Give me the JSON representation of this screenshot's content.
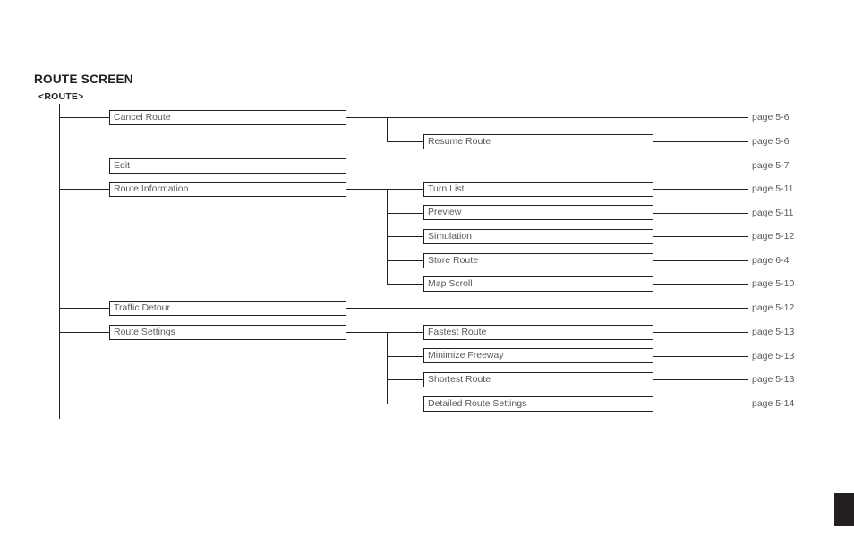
{
  "header": {
    "title": "ROUTE SCREEN",
    "subtitle": "<ROUTE>"
  },
  "chart_data": {
    "type": "diagram",
    "title": "ROUTE SCREEN",
    "subtitle": "<ROUTE>",
    "root": "<ROUTE>",
    "nodes": [
      {
        "id": "cancel-route",
        "level": 1,
        "label": "Cancel Route",
        "page": "page 5-6",
        "children": [
          {
            "id": "resume-route",
            "level": 2,
            "label": "Resume Route",
            "page": "page 5-6"
          }
        ]
      },
      {
        "id": "edit",
        "level": 1,
        "label": "Edit",
        "page": "page 5-7",
        "children": []
      },
      {
        "id": "route-information",
        "level": 1,
        "label": "Route Information",
        "page": null,
        "children": [
          {
            "id": "turn-list",
            "level": 2,
            "label": "Turn List",
            "page": "page 5-11"
          },
          {
            "id": "preview",
            "level": 2,
            "label": "Preview",
            "page": "page 5-11"
          },
          {
            "id": "simulation",
            "level": 2,
            "label": "Simulation",
            "page": "page 5-12"
          },
          {
            "id": "store-route",
            "level": 2,
            "label": "Store Route",
            "page": "page 6-4"
          },
          {
            "id": "map-scroll",
            "level": 2,
            "label": "Map Scroll",
            "page": "page 5-10"
          }
        ]
      },
      {
        "id": "traffic-detour",
        "level": 1,
        "label": "Traffic Detour",
        "page": "page 5-12",
        "children": []
      },
      {
        "id": "route-settings",
        "level": 1,
        "label": "Route Settings",
        "page": null,
        "children": [
          {
            "id": "fastest-route",
            "level": 2,
            "label": "Fastest Route",
            "page": "page 5-13"
          },
          {
            "id": "minimize-freeway",
            "level": 2,
            "label": "Minimize Freeway",
            "page": "page 5-13"
          },
          {
            "id": "shortest-route",
            "level": 2,
            "label": "Shortest Route",
            "page": "page 5-13"
          },
          {
            "id": "detailed-route-settings",
            "level": 2,
            "label": "Detailed Route Settings",
            "page": "page 5-14"
          }
        ]
      }
    ]
  },
  "boxes": {
    "cancel_route": "Cancel Route",
    "resume_route": "Resume Route",
    "edit": "Edit",
    "route_information": "Route Information",
    "turn_list": "Turn List",
    "preview": "Preview",
    "simulation": "Simulation",
    "store_route": "Store Route",
    "map_scroll": "Map Scroll",
    "traffic_detour": "Traffic Detour",
    "route_settings": "Route Settings",
    "fastest_route": "Fastest Route",
    "minimize_freeway": "Minimize Freeway",
    "shortest_route": "Shortest Route",
    "detailed_route_settings": "Detailed Route Settings"
  },
  "pages": {
    "cancel_route": "page 5-6",
    "resume_route": "page 5-6",
    "edit": "page 5-7",
    "turn_list": "page 5-11",
    "preview": "page 5-11",
    "simulation": "page 5-12",
    "store_route": "page 6-4",
    "map_scroll": "page 5-10",
    "traffic_detour": "page 5-12",
    "fastest_route": "page 5-13",
    "minimize_freeway": "page 5-13",
    "shortest_route": "page 5-13",
    "detailed_route_settings": "page 5-14"
  },
  "colors": {
    "ink": "#231f20",
    "label": "#58595b",
    "background": "#ffffff"
  }
}
